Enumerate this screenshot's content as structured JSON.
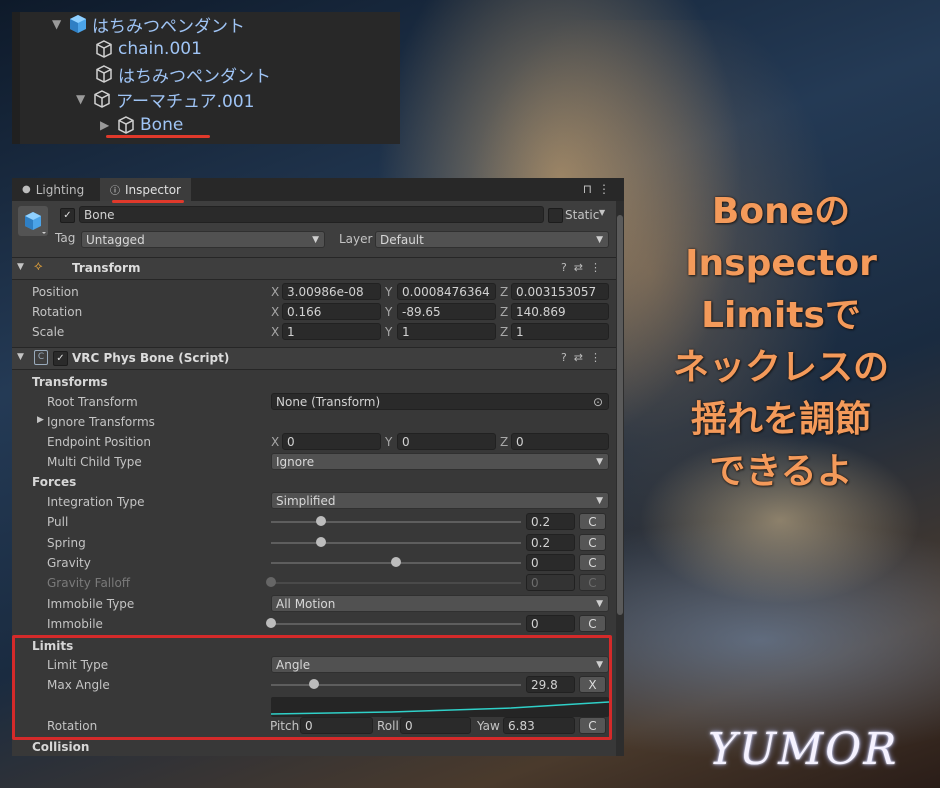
{
  "hierarchy": {
    "items": [
      {
        "label": "はちみつペンダント",
        "expanded": true
      },
      {
        "label": "chain.001"
      },
      {
        "label": "はちみつペンダント"
      },
      {
        "label": "アーマチュア.001",
        "expanded": true
      },
      {
        "label": "Bone",
        "collapsed": true
      }
    ]
  },
  "tabs": [
    {
      "label": "Lighting",
      "icon": "lightbulb-icon"
    },
    {
      "label": "Inspector",
      "icon": "info-icon"
    }
  ],
  "object": {
    "name": "Bone",
    "static_label": "Static",
    "tag_label": "Tag",
    "tag_value": "Untagged",
    "layer_label": "Layer",
    "layer_value": "Default"
  },
  "transform": {
    "title": "Transform",
    "position_label": "Position",
    "rotation_label": "Rotation",
    "scale_label": "Scale",
    "position": {
      "x": "3.00986e-08",
      "y": "0.0008476364",
      "z": "0.003153057"
    },
    "rotation": {
      "x": "0.166",
      "y": "-89.65",
      "z": "140.869"
    },
    "scale": {
      "x": "1",
      "y": "1",
      "z": "1"
    },
    "axes": {
      "x": "X",
      "y": "Y",
      "z": "Z"
    }
  },
  "physbone": {
    "title": "VRC Phys Bone (Script)",
    "transforms_header": "Transforms",
    "root_transform_label": "Root Transform",
    "root_transform_value": "None (Transform)",
    "ignore_transforms_label": "Ignore Transforms",
    "endpoint_label": "Endpoint Position",
    "endpoint": {
      "x": "0",
      "y": "0",
      "z": "0"
    },
    "multi_child_label": "Multi Child Type",
    "multi_child_value": "Ignore",
    "forces_header": "Forces",
    "integration_label": "Integration Type",
    "integration_value": "Simplified",
    "pull_label": "Pull",
    "pull_value": "0.2",
    "spring_label": "Spring",
    "spring_value": "0.2",
    "gravity_label": "Gravity",
    "gravity_value": "0",
    "gravity_falloff_label": "Gravity Falloff",
    "gravity_falloff_value": "0",
    "immobile_type_label": "Immobile Type",
    "immobile_type_value": "All Motion",
    "immobile_label": "Immobile",
    "immobile_value": "0",
    "limits_header": "Limits",
    "limit_type_label": "Limit Type",
    "limit_type_value": "Angle",
    "max_angle_label": "Max Angle",
    "max_angle_value": "29.8",
    "rotation_label": "Rotation",
    "pitch_label": "Pitch",
    "pitch_value": "0",
    "roll_label": "Roll",
    "roll_value": "0",
    "yaw_label": "Yaw",
    "yaw_value": "6.83",
    "collision_header": "Collision",
    "c_button": "C",
    "x_button": "X"
  },
  "slider_levels": {
    "pull": 0.2,
    "spring": 0.2,
    "gravity": 0.5,
    "gravity_falloff": 0,
    "immobile": 0,
    "max_angle": 0.17
  },
  "annotation": {
    "lines": [
      "Boneの",
      "Inspector",
      "Limitsで",
      "ネックレスの",
      "揺れを調節",
      "できるよ"
    ]
  },
  "signature": "YUMOR",
  "colors": {
    "accent_orange": "#f49a5a",
    "highlight_red": "#d42a2a",
    "hierarchy_blue": "#9fc4f5"
  }
}
